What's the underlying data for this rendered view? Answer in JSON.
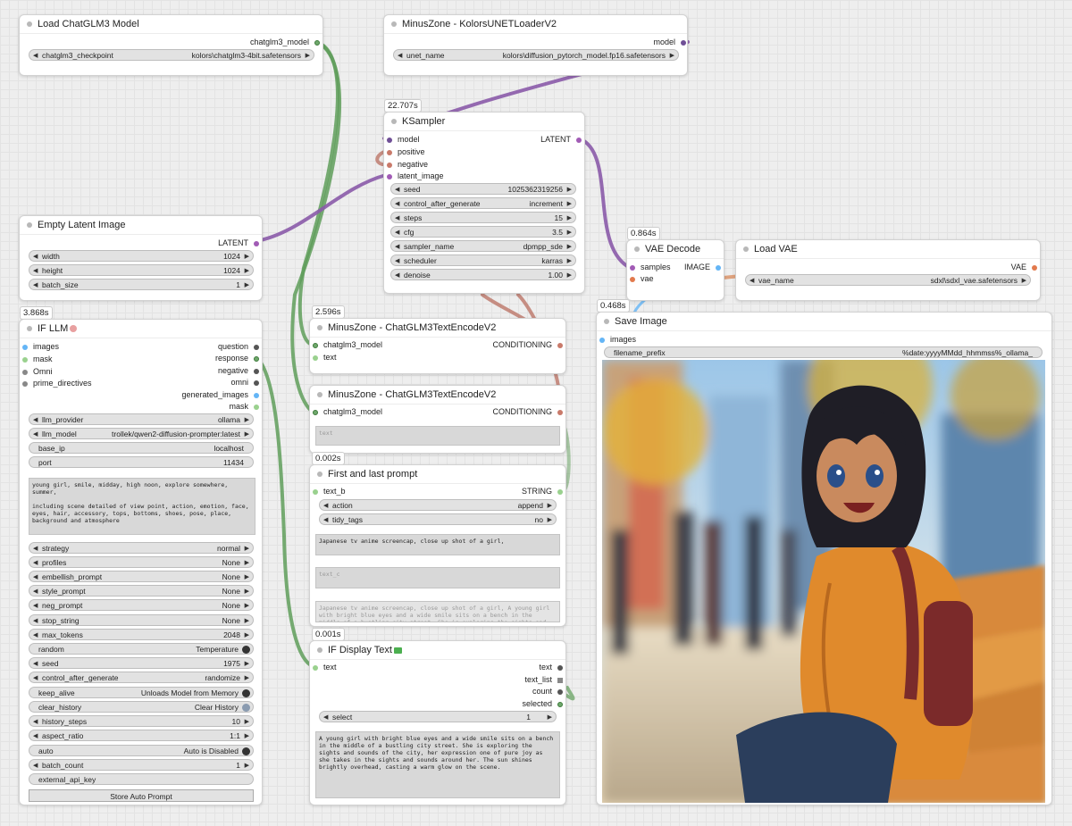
{
  "nodes": {
    "load_chatglm": {
      "title": "Load ChatGLM3 Model",
      "output": "chatglm3_model",
      "checkpoint": {
        "label": "chatglm3_checkpoint",
        "value": "kolors\\chatglm3-4bit.safetensors"
      }
    },
    "unet_loader": {
      "title": "MinusZone - KolorsUNETLoaderV2",
      "output": "model",
      "unet_name": {
        "label": "unet_name",
        "value": "kolors\\diffusion_pytorch_model.fp16.safetensors"
      }
    },
    "ksampler": {
      "timing": "22.707s",
      "title": "KSampler",
      "inputs": [
        "model",
        "positive",
        "negative",
        "latent_image"
      ],
      "output": "LATENT",
      "widgets": [
        {
          "label": "seed",
          "value": "1025362319256"
        },
        {
          "label": "control_after_generate",
          "value": "increment"
        },
        {
          "label": "steps",
          "value": "15"
        },
        {
          "label": "cfg",
          "value": "3.5"
        },
        {
          "label": "sampler_name",
          "value": "dpmpp_sde"
        },
        {
          "label": "scheduler",
          "value": "karras"
        },
        {
          "label": "denoise",
          "value": "1.00"
        }
      ]
    },
    "empty_latent": {
      "title": "Empty Latent Image",
      "output": "LATENT",
      "widgets": [
        {
          "label": "width",
          "value": "1024"
        },
        {
          "label": "height",
          "value": "1024"
        },
        {
          "label": "batch_size",
          "value": "1"
        }
      ]
    },
    "vae_decode": {
      "timing": "0.864s",
      "title": "VAE Decode",
      "inputs": [
        "samples",
        "vae"
      ],
      "output": "IMAGE"
    },
    "load_vae": {
      "title": "Load VAE",
      "output": "VAE",
      "vae_name": {
        "label": "vae_name",
        "value": "sdxl\\sdxl_vae.safetensors"
      }
    },
    "if_llm": {
      "timing": "3.868s",
      "title": "IF LLM",
      "inputs": [
        "images",
        "mask",
        "Omni",
        "prime_directives"
      ],
      "outputs": [
        "question",
        "response",
        "negative",
        "omni",
        "generated_images",
        "mask"
      ],
      "widgets_top": [
        {
          "label": "llm_provider",
          "value": "ollama"
        },
        {
          "label": "llm_model",
          "value": "trollek/qwen2-diffusion-prompter:latest"
        }
      ],
      "base_ip": {
        "label": "base_ip",
        "value": "localhost"
      },
      "port": {
        "label": "port",
        "value": "11434"
      },
      "prompt_text": "young girl, smile, midday, high noon, explore somewhere, summer,\n\nincluding scene detailed of view point, action, emotion, face, eyes, hair, accessory, tops, bottoms, shoes, pose, place, background and atmosphere",
      "widgets_bottom": [
        {
          "label": "strategy",
          "value": "normal"
        },
        {
          "label": "profiles",
          "value": "None"
        },
        {
          "label": "embellish_prompt",
          "value": "None"
        },
        {
          "label": "style_prompt",
          "value": "None"
        },
        {
          "label": "neg_prompt",
          "value": "None"
        },
        {
          "label": "stop_string",
          "value": "None"
        },
        {
          "label": "max_tokens",
          "value": "2048"
        }
      ],
      "random": {
        "label": "random",
        "value": "Temperature"
      },
      "seed": {
        "label": "seed",
        "value": "1975"
      },
      "control_after_generate": {
        "label": "control_after_generate",
        "value": "randomize"
      },
      "keep_alive": {
        "label": "keep_alive",
        "value": "Unloads Model from Memory"
      },
      "clear_history": {
        "label": "clear_history",
        "value": "Clear History"
      },
      "history_steps": {
        "label": "history_steps",
        "value": "10"
      },
      "aspect_ratio": {
        "label": "aspect_ratio",
        "value": "1:1"
      },
      "auto": {
        "label": "auto",
        "value": "Auto is Disabled"
      },
      "batch_count": {
        "label": "batch_count",
        "value": "1"
      },
      "external_api_key": {
        "label": "external_api_key"
      },
      "store_button": "Store Auto Prompt"
    },
    "text_encode_1": {
      "timing": "2.596s",
      "title": "MinusZone - ChatGLM3TextEncodeV2",
      "inputs": [
        "chatglm3_model",
        "text"
      ],
      "output": "CONDITIONING"
    },
    "text_encode_2": {
      "title": "MinusZone - ChatGLM3TextEncodeV2",
      "inputs": [
        "chatglm3_model"
      ],
      "output": "CONDITIONING",
      "text_placeholder": "text"
    },
    "first_last": {
      "timing": "0.002s",
      "title": "First and last prompt",
      "input": "text_b",
      "output": "STRING",
      "widgets": [
        {
          "label": "action",
          "value": "append"
        },
        {
          "label": "tidy_tags",
          "value": "no"
        }
      ],
      "text_a": "Japanese tv anime screencap, close up shot of a girl,",
      "text_c_placeholder": "text_c",
      "preview": "Japanese tv anime screencap, close up shot of a girl, A young girl with bright blue eyes and a wide smile sits on a bench in the middle of a bustling city street. She is exploring the sights and sounds of the city."
    },
    "display_text": {
      "timing": "0.001s",
      "title": "IF Display Text",
      "input": "text",
      "outputs": [
        "text",
        "text_list",
        "count",
        "selected"
      ],
      "select": {
        "label": "select",
        "value": "1"
      },
      "text": "A young girl with bright blue eyes and a wide smile sits on a bench in the middle of a bustling city street. She is exploring the sights and sounds of the city, her expression one of pure joy as she takes in the sights and sounds around her. The sun shines brightly overhead, casting a warm glow on the scene."
    },
    "save_image": {
      "timing": "0.468s",
      "title": "Save Image",
      "input": "images",
      "filename_prefix": {
        "label": "filename_prefix",
        "value": "%date:yyyyMMdd_hhmmss%_ollama_"
      }
    }
  },
  "colors": {
    "model_wire": "#8a5aa8",
    "clip_wire": "#5f9e5a",
    "cond_wire": "#b86e5f",
    "vae_wire": "#d98a5a",
    "image_wire": "#64b5f6"
  }
}
